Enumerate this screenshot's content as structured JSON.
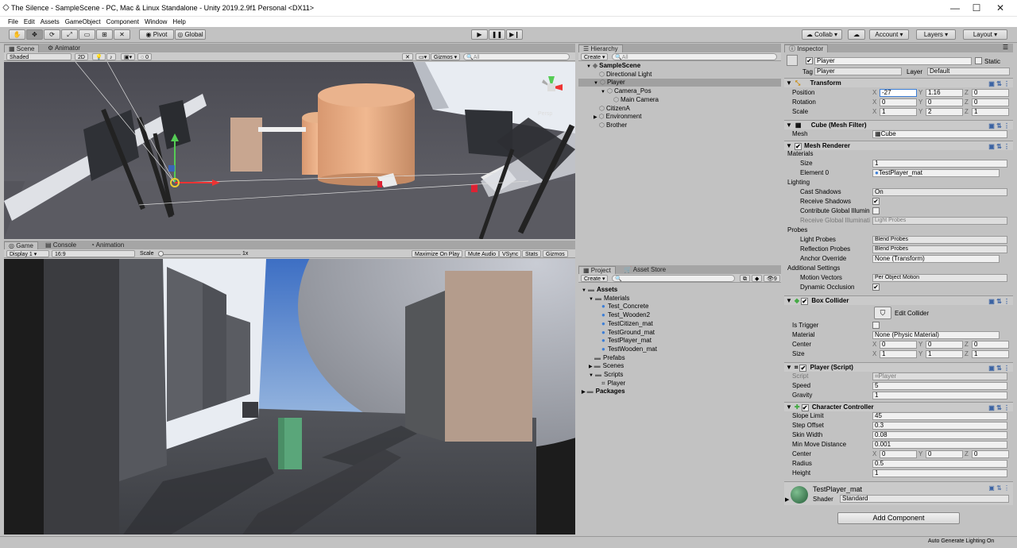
{
  "window": {
    "title": "The Silence - SampleScene - PC, Mac & Linux Standalone - Unity 2019.2.9f1 Personal <DX11>",
    "min": "—",
    "max": "☐",
    "close": "✕"
  },
  "menu": [
    "File",
    "Edit",
    "Assets",
    "GameObject",
    "Component",
    "Window",
    "Help"
  ],
  "toolbar": {
    "pivot": "Pivot",
    "global": "Global",
    "collab": "Collab",
    "account": "Account",
    "layers": "Layers",
    "layout": "Layout"
  },
  "scene": {
    "tabs": [
      "Scene",
      "Animator"
    ],
    "shading": "Shaded",
    "mode2d": "2D",
    "fx_count": "0",
    "gizmos": "Gizmos",
    "search": "All",
    "persp": "Persp"
  },
  "game": {
    "tabs": [
      "Game",
      "Console",
      "Animation"
    ],
    "display": "Display 1",
    "aspect": "16:9",
    "scale_label": "Scale",
    "scale_value": "1x",
    "buttons": [
      "Maximize On Play",
      "Mute Audio",
      "VSync",
      "Stats",
      "Gizmos"
    ]
  },
  "hierarchy": {
    "tab": "Hierarchy",
    "create": "Create",
    "search": "All",
    "items": [
      {
        "label": "SampleScene",
        "depth": 0,
        "arrow": "▼",
        "bold": true
      },
      {
        "label": "Directional Light",
        "depth": 1,
        "arrow": ""
      },
      {
        "label": "Player",
        "depth": 1,
        "arrow": "▼",
        "selected": true
      },
      {
        "label": "Camera_Pos",
        "depth": 2,
        "arrow": "▼"
      },
      {
        "label": "Main Camera",
        "depth": 3,
        "arrow": ""
      },
      {
        "label": "CitizenA",
        "depth": 1,
        "arrow": ""
      },
      {
        "label": "Environment",
        "depth": 1,
        "arrow": "▶"
      },
      {
        "label": "Brother",
        "depth": 1,
        "arrow": ""
      }
    ]
  },
  "project": {
    "tabs": [
      "Project",
      "Asset Store"
    ],
    "create": "Create",
    "count": "9",
    "items": [
      {
        "label": "Assets",
        "depth": 0,
        "arrow": "▼",
        "bold": true,
        "kind": "folder"
      },
      {
        "label": "Materials",
        "depth": 1,
        "arrow": "▼",
        "kind": "folder"
      },
      {
        "label": "Test_Concrete",
        "depth": 2,
        "arrow": "",
        "kind": "mat"
      },
      {
        "label": "Test_Wooden2",
        "depth": 2,
        "arrow": "",
        "kind": "mat"
      },
      {
        "label": "TestCitizen_mat",
        "depth": 2,
        "arrow": "",
        "kind": "mat"
      },
      {
        "label": "TestGround_mat",
        "depth": 2,
        "arrow": "",
        "kind": "mat"
      },
      {
        "label": "TestPlayer_mat",
        "depth": 2,
        "arrow": "",
        "kind": "mat"
      },
      {
        "label": "TestWooden_mat",
        "depth": 2,
        "arrow": "",
        "kind": "mat"
      },
      {
        "label": "Prefabs",
        "depth": 1,
        "arrow": "",
        "kind": "folder"
      },
      {
        "label": "Scenes",
        "depth": 1,
        "arrow": "▶",
        "kind": "folder"
      },
      {
        "label": "Scripts",
        "depth": 1,
        "arrow": "▼",
        "kind": "folder"
      },
      {
        "label": "Player",
        "depth": 2,
        "arrow": "",
        "kind": "script"
      },
      {
        "label": "Packages",
        "depth": 0,
        "arrow": "▶",
        "bold": true,
        "kind": "folder"
      }
    ]
  },
  "inspector": {
    "tab": "Inspector",
    "name": "Player",
    "static": "Static",
    "tag_label": "Tag",
    "tag": "Player",
    "layer_label": "Layer",
    "layer": "Default",
    "transform": {
      "title": "Transform",
      "position": {
        "label": "Position",
        "x": "-27",
        "y": "1.16",
        "z": "0"
      },
      "rotation": {
        "label": "Rotation",
        "x": "0",
        "y": "0",
        "z": "0"
      },
      "scale": {
        "label": "Scale",
        "x": "1",
        "y": "2",
        "z": "1"
      }
    },
    "meshfilter": {
      "title": "Cube (Mesh Filter)",
      "mesh_label": "Mesh",
      "mesh": "Cube"
    },
    "meshrenderer": {
      "title": "Mesh Renderer",
      "materials": "Materials",
      "size_label": "Size",
      "size": "1",
      "element_label": "Element 0",
      "element": "TestPlayer_mat",
      "lighting": "Lighting",
      "cast_label": "Cast Shadows",
      "cast": "On",
      "receive_label": "Receive Shadows",
      "contrib_label": "Contribute Global Illumin",
      "receivegi_label": "Receive Global Illuminati",
      "receivegi": "Light Probes",
      "probes": "Probes",
      "lightprobes_label": "Light Probes",
      "lightprobes": "Blend Probes",
      "reflprobes_label": "Reflection Probes",
      "reflprobes": "Blend Probes",
      "anchor_label": "Anchor Override",
      "anchor": "None (Transform)",
      "additional": "Additional Settings",
      "motion_label": "Motion Vectors",
      "motion": "Per Object Motion",
      "occlusion_label": "Dynamic Occlusion"
    },
    "boxcollider": {
      "title": "Box Collider",
      "edit": "Edit Collider",
      "trigger_label": "Is Trigger",
      "material_label": "Material",
      "material": "None (Physic Material)",
      "center_label": "Center",
      "center": {
        "x": "0",
        "y": "0",
        "z": "0"
      },
      "size_label": "Size",
      "size": {
        "x": "1",
        "y": "1",
        "z": "1"
      }
    },
    "playerscript": {
      "title": "Player (Script)",
      "script_label": "Script",
      "script": "Player",
      "speed_label": "Speed",
      "speed": "5",
      "gravity_label": "Gravity",
      "gravity": "1"
    },
    "charcontroller": {
      "title": "Character Controller",
      "slope_label": "Slope Limit",
      "slope": "45",
      "step_label": "Step Offset",
      "step": "0.3",
      "skin_label": "Skin Width",
      "skin": "0.08",
      "minmove_label": "Min Move Distance",
      "minmove": "0.001",
      "center_label": "Center",
      "center": {
        "x": "0",
        "y": "0",
        "z": "0"
      },
      "radius_label": "Radius",
      "radius": "0.5",
      "height_label": "Height",
      "height": "1"
    },
    "material": {
      "name": "TestPlayer_mat",
      "shader_label": "Shader",
      "shader": "Standard"
    },
    "add_component": "Add Component"
  },
  "status": "Auto Generate Lighting On"
}
